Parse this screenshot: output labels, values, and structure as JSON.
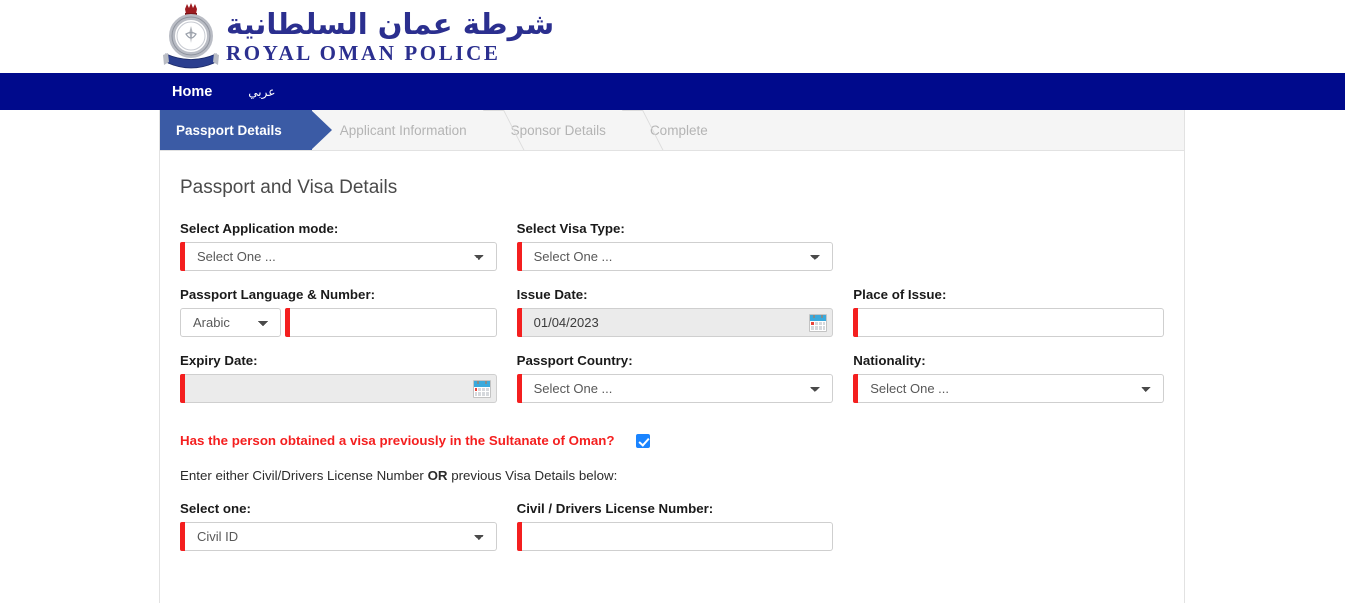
{
  "brand": {
    "arabic_name": "شرطة عمان السلطانية",
    "latin_name": "ROYAL OMAN POLICE",
    "emblem_name": "royal-oman-police-emblem",
    "brand_color": "#2b2f8f",
    "navbar_color": "#000a8c"
  },
  "navbar": {
    "home_label": "Home",
    "arabic_label": "عربي"
  },
  "stepper": {
    "steps": [
      {
        "label": "Passport Details",
        "active": true
      },
      {
        "label": "Applicant Information",
        "active": false
      },
      {
        "label": "Sponsor Details",
        "active": false
      },
      {
        "label": "Complete",
        "active": false
      }
    ],
    "active_color": "#3b5ba5",
    "inactive_color": "#b4b4b4"
  },
  "form": {
    "title": "Passport and Visa Details",
    "required_marker_color": "#f41f1f",
    "fields": {
      "application_mode": {
        "label": "Select Application mode:",
        "value": "Select One ...",
        "type": "select",
        "required": true
      },
      "visa_type": {
        "label": "Select Visa Type:",
        "value": "Select One ...",
        "type": "select",
        "required": true
      },
      "passport_language_number": {
        "label": "Passport Language & Number:",
        "language_value": "Arabic",
        "number_value": "",
        "number_placeholder": "",
        "required": true
      },
      "issue_date": {
        "label": "Issue Date:",
        "value": "01/04/2023",
        "type": "date",
        "required": true,
        "icon": "calendar-icon"
      },
      "place_of_issue": {
        "label": "Place of Issue:",
        "value": "",
        "placeholder": "",
        "type": "text",
        "required": true
      },
      "expiry_date": {
        "label": "Expiry Date:",
        "value": "",
        "type": "date",
        "required": true,
        "icon": "calendar-icon"
      },
      "passport_country": {
        "label": "Passport Country:",
        "value": "Select One ...",
        "type": "select",
        "required": true
      },
      "nationality": {
        "label": "Nationality:",
        "value": "Select One ...",
        "type": "select",
        "required": true
      },
      "select_one": {
        "label": "Select one:",
        "value": "Civil ID",
        "type": "select",
        "required": true
      },
      "civil_license_number": {
        "label": "Civil / Drivers License Number:",
        "value": "",
        "placeholder": "",
        "type": "text",
        "required": true
      }
    },
    "previous_visa_question": {
      "text": "Has the person obtained a visa previously in the Sultanate of Oman?",
      "checked": true,
      "color": "#f41f1f"
    },
    "hint": {
      "prefix": "Enter either Civil/Drivers License Number ",
      "emphasis": "OR",
      "suffix": " previous Visa Details below:"
    }
  }
}
